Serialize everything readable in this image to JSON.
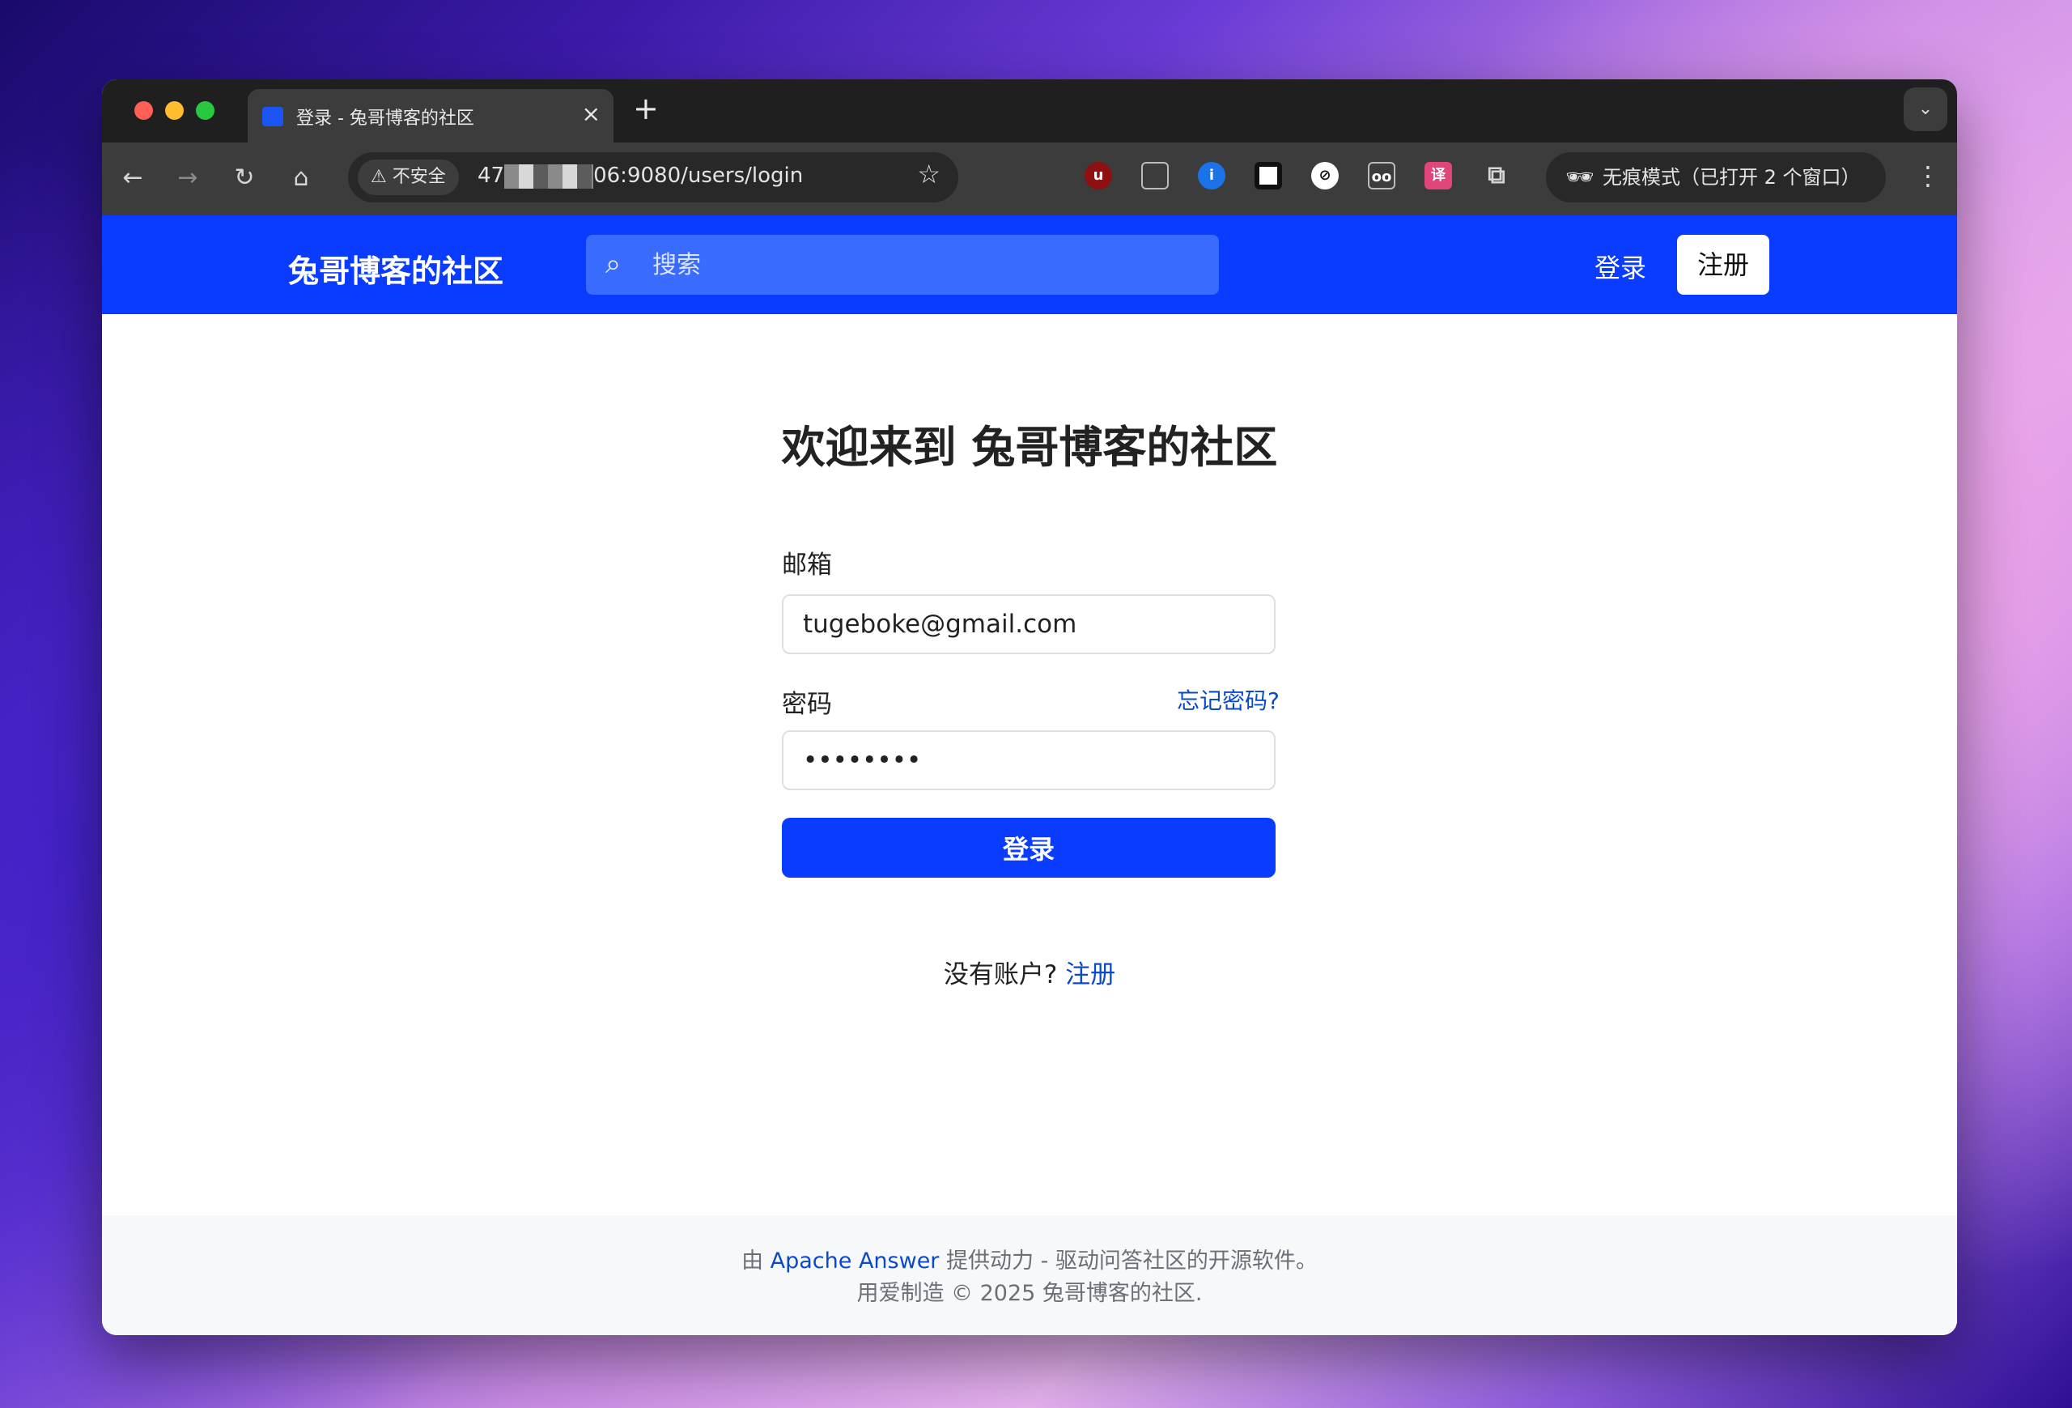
{
  "browser": {
    "tab_title": "登录 - 兔哥博客的社区",
    "tab_close": "×",
    "new_tab": "+",
    "not_secure": "不安全",
    "url_prefix": "47",
    "url_suffix": "06:9080/users/login",
    "incognito": "无痕模式（已打开 2 个窗口）"
  },
  "header": {
    "brand": "兔哥博客的社区",
    "search_placeholder": "搜索",
    "login_label": "登录",
    "signup_label": "注册"
  },
  "login_form": {
    "title": "欢迎来到 兔哥博客的社区",
    "email_label": "邮箱",
    "email_value": "tugeboke@gmail.com",
    "password_label": "密码",
    "forgot_label": "忘记密码?",
    "password_value": "••••••••",
    "submit_label": "登录",
    "no_account_text": "没有账户?",
    "signup_link": "注册"
  },
  "footer": {
    "powered_prefix": "由",
    "powered_link": "Apache Answer",
    "powered_suffix": "提供动力 - 驱动问答社区的开源软件。",
    "copyright": "用爱制造 © 2025 兔哥博客的社区."
  },
  "colors": {
    "brand_blue": "#0a3cff",
    "link_blue": "#0a4ac8"
  }
}
